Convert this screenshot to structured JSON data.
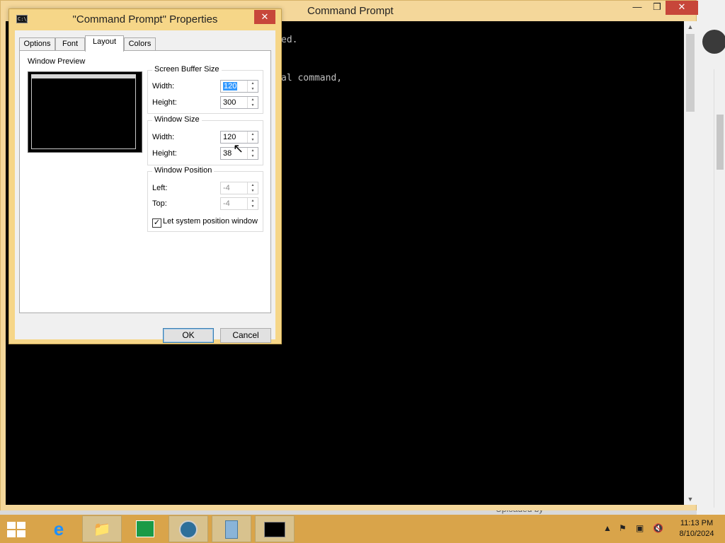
{
  "console": {
    "title": "Command Prompt",
    "minimize": "—",
    "maximize": "❒",
    "close": "✕",
    "lines": [
      "ed.",
      "al command,"
    ],
    "scroll_up": "▲",
    "scroll_down": "▼"
  },
  "dialog": {
    "title": "\"Command Prompt\" Properties",
    "close": "✕",
    "icon_text": "C:\\_",
    "tabs": [
      "Options",
      "Font",
      "Layout",
      "Colors"
    ],
    "active_tab": "Layout",
    "window_preview_label": "Window Preview",
    "screen_buffer": {
      "label": "Screen Buffer Size",
      "width_label": "Width:",
      "width_value": "120",
      "height_label": "Height:",
      "height_value": "300"
    },
    "window_size": {
      "label": "Window Size",
      "width_label": "Width:",
      "width_value": "120",
      "height_label": "Height:",
      "height_value": "38"
    },
    "window_position": {
      "label": "Window Position",
      "left_label": "Left:",
      "left_value": "-4",
      "top_label": "Top:",
      "top_value": "-4",
      "let_system_label": "Let system position window",
      "let_system_checked": true
    },
    "ok": "OK",
    "cancel": "Cancel"
  },
  "background": {
    "uploaded_text": "Uploaded by"
  },
  "taskbar": {
    "items": [
      "start-windows",
      "internet-explorer",
      "file-explorer",
      "windows-store",
      "chrome-like-browser",
      "file-manager",
      "command-prompt"
    ],
    "tray": {
      "clock_time": "11:13 PM",
      "clock_date": "8/10/2024"
    }
  }
}
